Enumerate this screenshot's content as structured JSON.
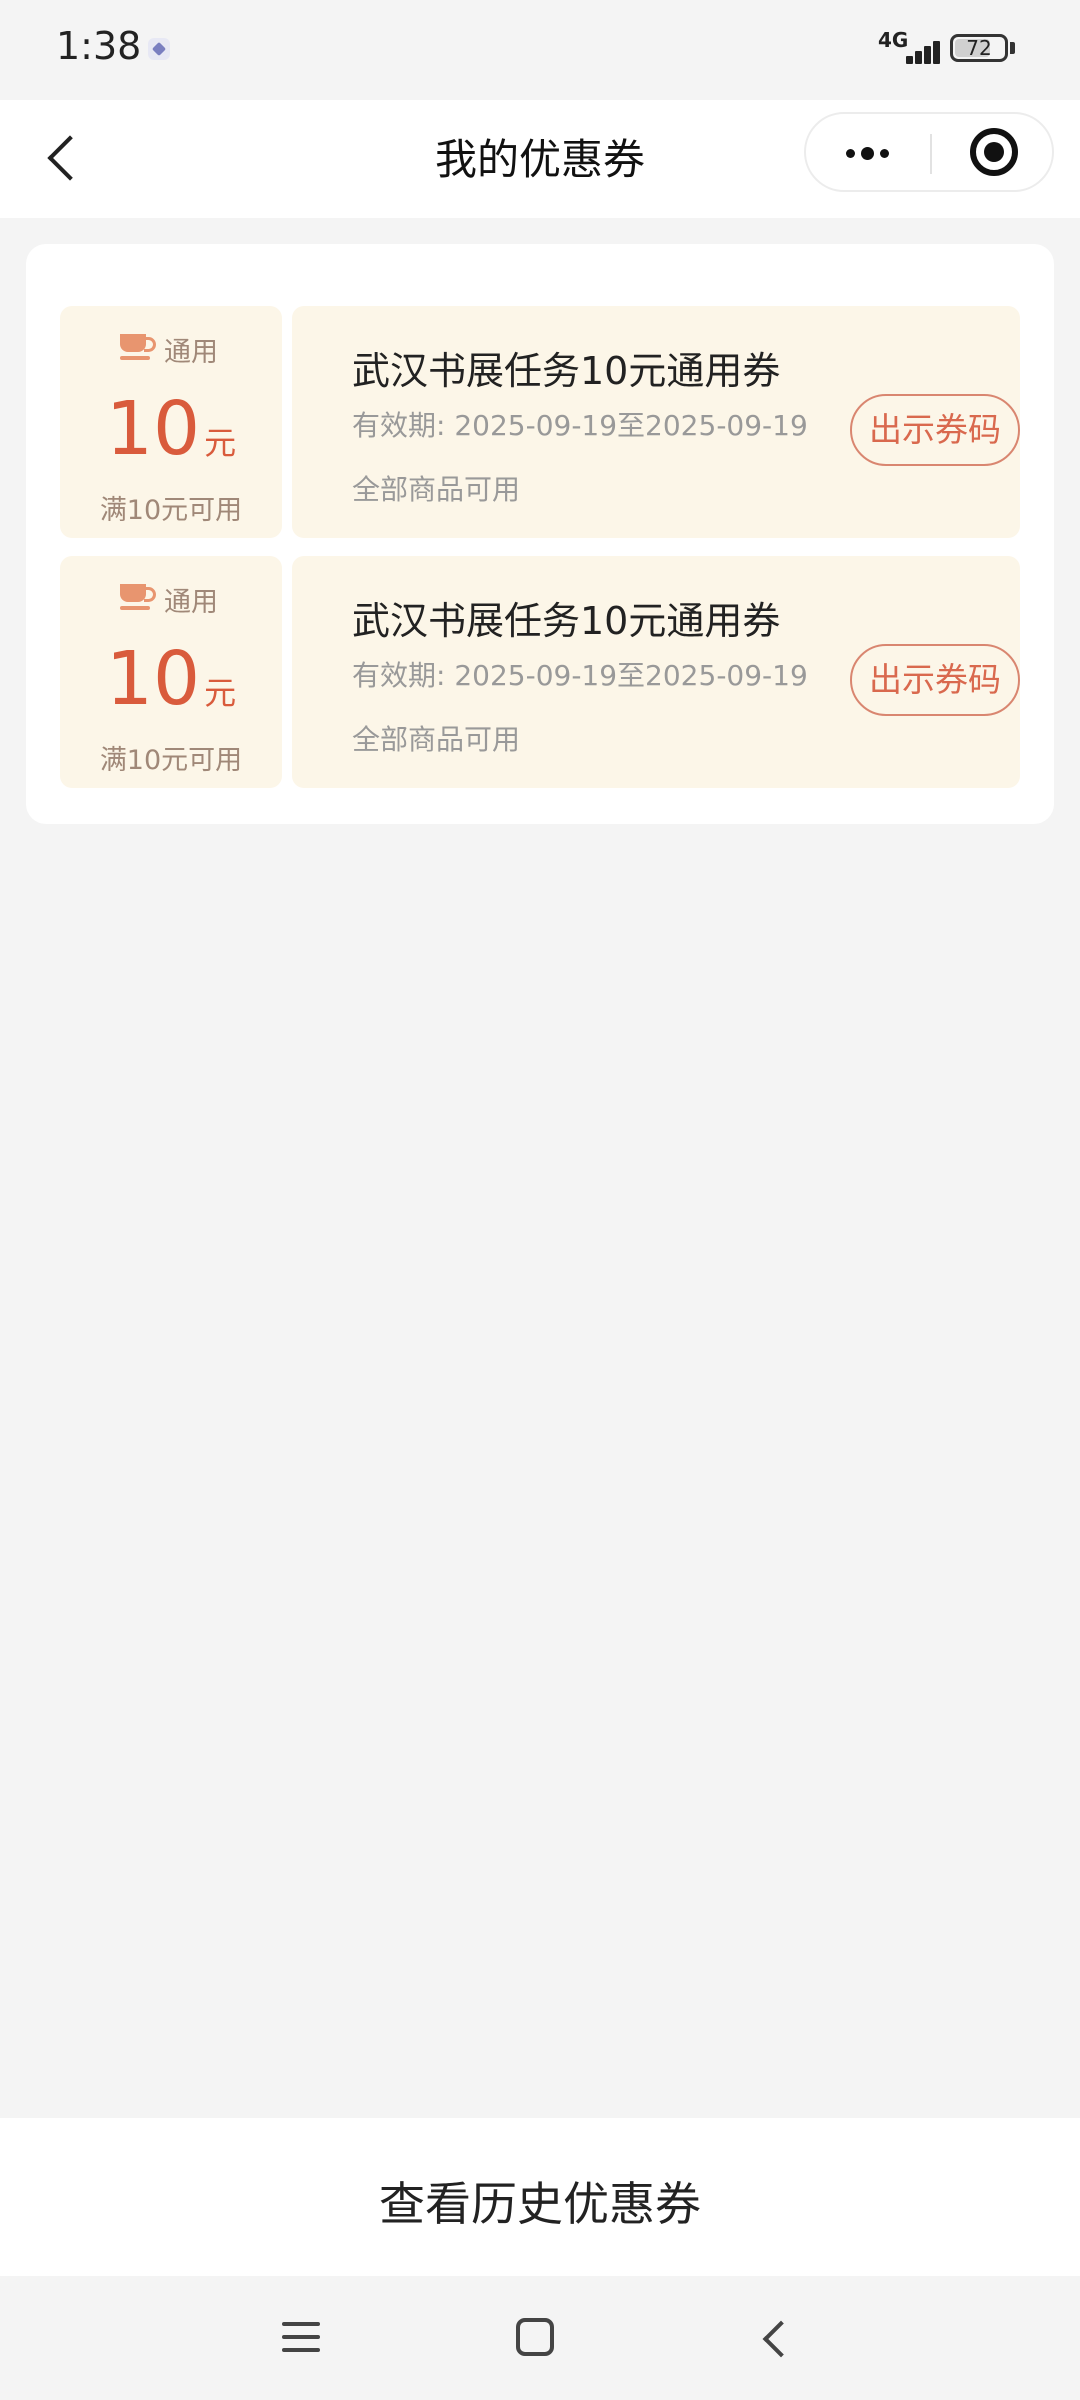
{
  "status_bar": {
    "time": "1:38",
    "network": "4G",
    "battery": 72,
    "battery_label": "72"
  },
  "header": {
    "title": "我的优惠券",
    "icons": [
      "back-arrow-icon",
      "more-dots-icon",
      "close-target-icon"
    ]
  },
  "coupons": [
    {
      "type_label": "通用",
      "amount": "10",
      "unit": "元",
      "threshold": "满10元可用",
      "title": "武汉书展任务10元通用券",
      "validity": "有效期: 2025-09-19至2025-09-19",
      "scope": "全部商品可用",
      "button_label": "出示券码"
    },
    {
      "type_label": "通用",
      "amount": "10",
      "unit": "元",
      "threshold": "满10元可用",
      "title": "武汉书展任务10元通用券",
      "validity": "有效期: 2025-09-19至2025-09-19",
      "scope": "全部商品可用",
      "button_label": "出示券码"
    }
  ],
  "footer": {
    "history_label": "查看历史优惠券"
  },
  "colors": {
    "accent": "#d95b3c",
    "coupon_bg": "#fcf6e8",
    "page_bg": "#f4f4f4"
  }
}
